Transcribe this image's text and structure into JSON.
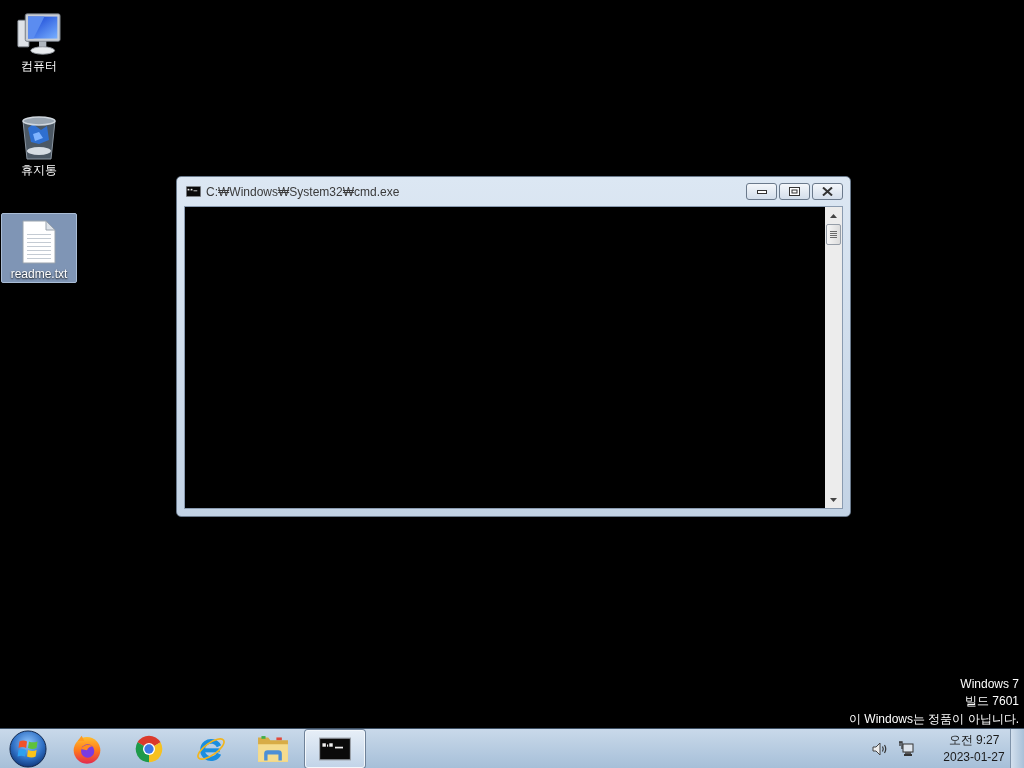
{
  "desktop": {
    "icons": [
      {
        "kind": "computer",
        "label": "컴퓨터",
        "selected": false
      },
      {
        "kind": "trash",
        "label": "휴지통",
        "selected": false
      },
      {
        "kind": "textfile",
        "label": "readme.txt",
        "selected": true
      }
    ],
    "watermark_lines": [
      "Windows 7",
      "빌드 7601",
      "이 Windows는 정품이 아닙니다."
    ]
  },
  "window": {
    "title": "C:₩Windows₩System32₩cmd.exe"
  },
  "taskbar": {
    "buttons": [
      {
        "kind": "fox",
        "selected": false
      },
      {
        "kind": "ring",
        "selected": false
      },
      {
        "kind": "ebrowser",
        "selected": false
      },
      {
        "kind": "folder",
        "selected": false
      },
      {
        "kind": "terminal",
        "selected": true
      }
    ],
    "clock": {
      "time": "오전 9:27",
      "date": "2023-01-27"
    }
  }
}
